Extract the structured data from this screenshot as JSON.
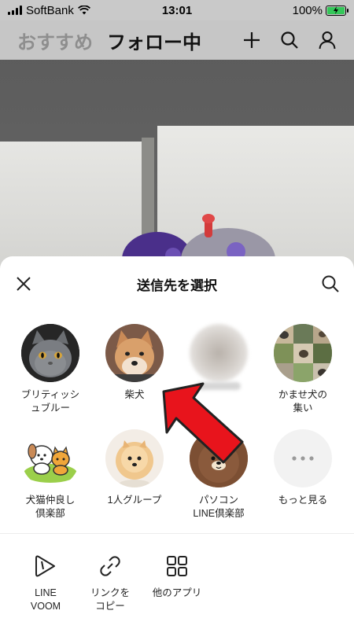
{
  "status_bar": {
    "carrier": "SoftBank",
    "time": "13:01",
    "battery": "100%",
    "battery_level": 1.0
  },
  "top_nav": {
    "tabs": [
      {
        "label": "おすすめ",
        "active": false
      },
      {
        "label": "フォロー中",
        "active": true
      }
    ],
    "icons": [
      "plus-icon",
      "search-icon",
      "profile-icon"
    ]
  },
  "sheet": {
    "title": "送信先を選択",
    "close_icon": "close-icon",
    "search_icon": "search-icon",
    "contacts": [
      {
        "label": "ブリティッシ\nュブルー",
        "avatar": "gray-cat"
      },
      {
        "label": "柴犬",
        "avatar": "shiba-dog"
      },
      {
        "label": "",
        "avatar": "blurred"
      },
      {
        "label": "かませ犬の\n集い",
        "avatar": "dogs-collage"
      },
      {
        "label": "犬猫仲良し\n倶楽部",
        "avatar": "dog-cat-illustration"
      },
      {
        "label": "1人グループ",
        "avatar": "pomeranian"
      },
      {
        "label": "パソコン\nLINE倶楽部",
        "avatar": "brown-bear"
      },
      {
        "label": "もっと見る",
        "avatar": "more-icon"
      }
    ],
    "apps": [
      {
        "label": "LINE\nVOOM",
        "icon": "voom-icon"
      },
      {
        "label": "リンクを\nコピー",
        "icon": "link-icon"
      },
      {
        "label": "他のアプリ",
        "icon": "apps-grid-icon"
      }
    ]
  },
  "colors": {
    "accent_red": "#e8141c",
    "sheet_bg": "#ffffff",
    "battery_green": "#34c759"
  }
}
